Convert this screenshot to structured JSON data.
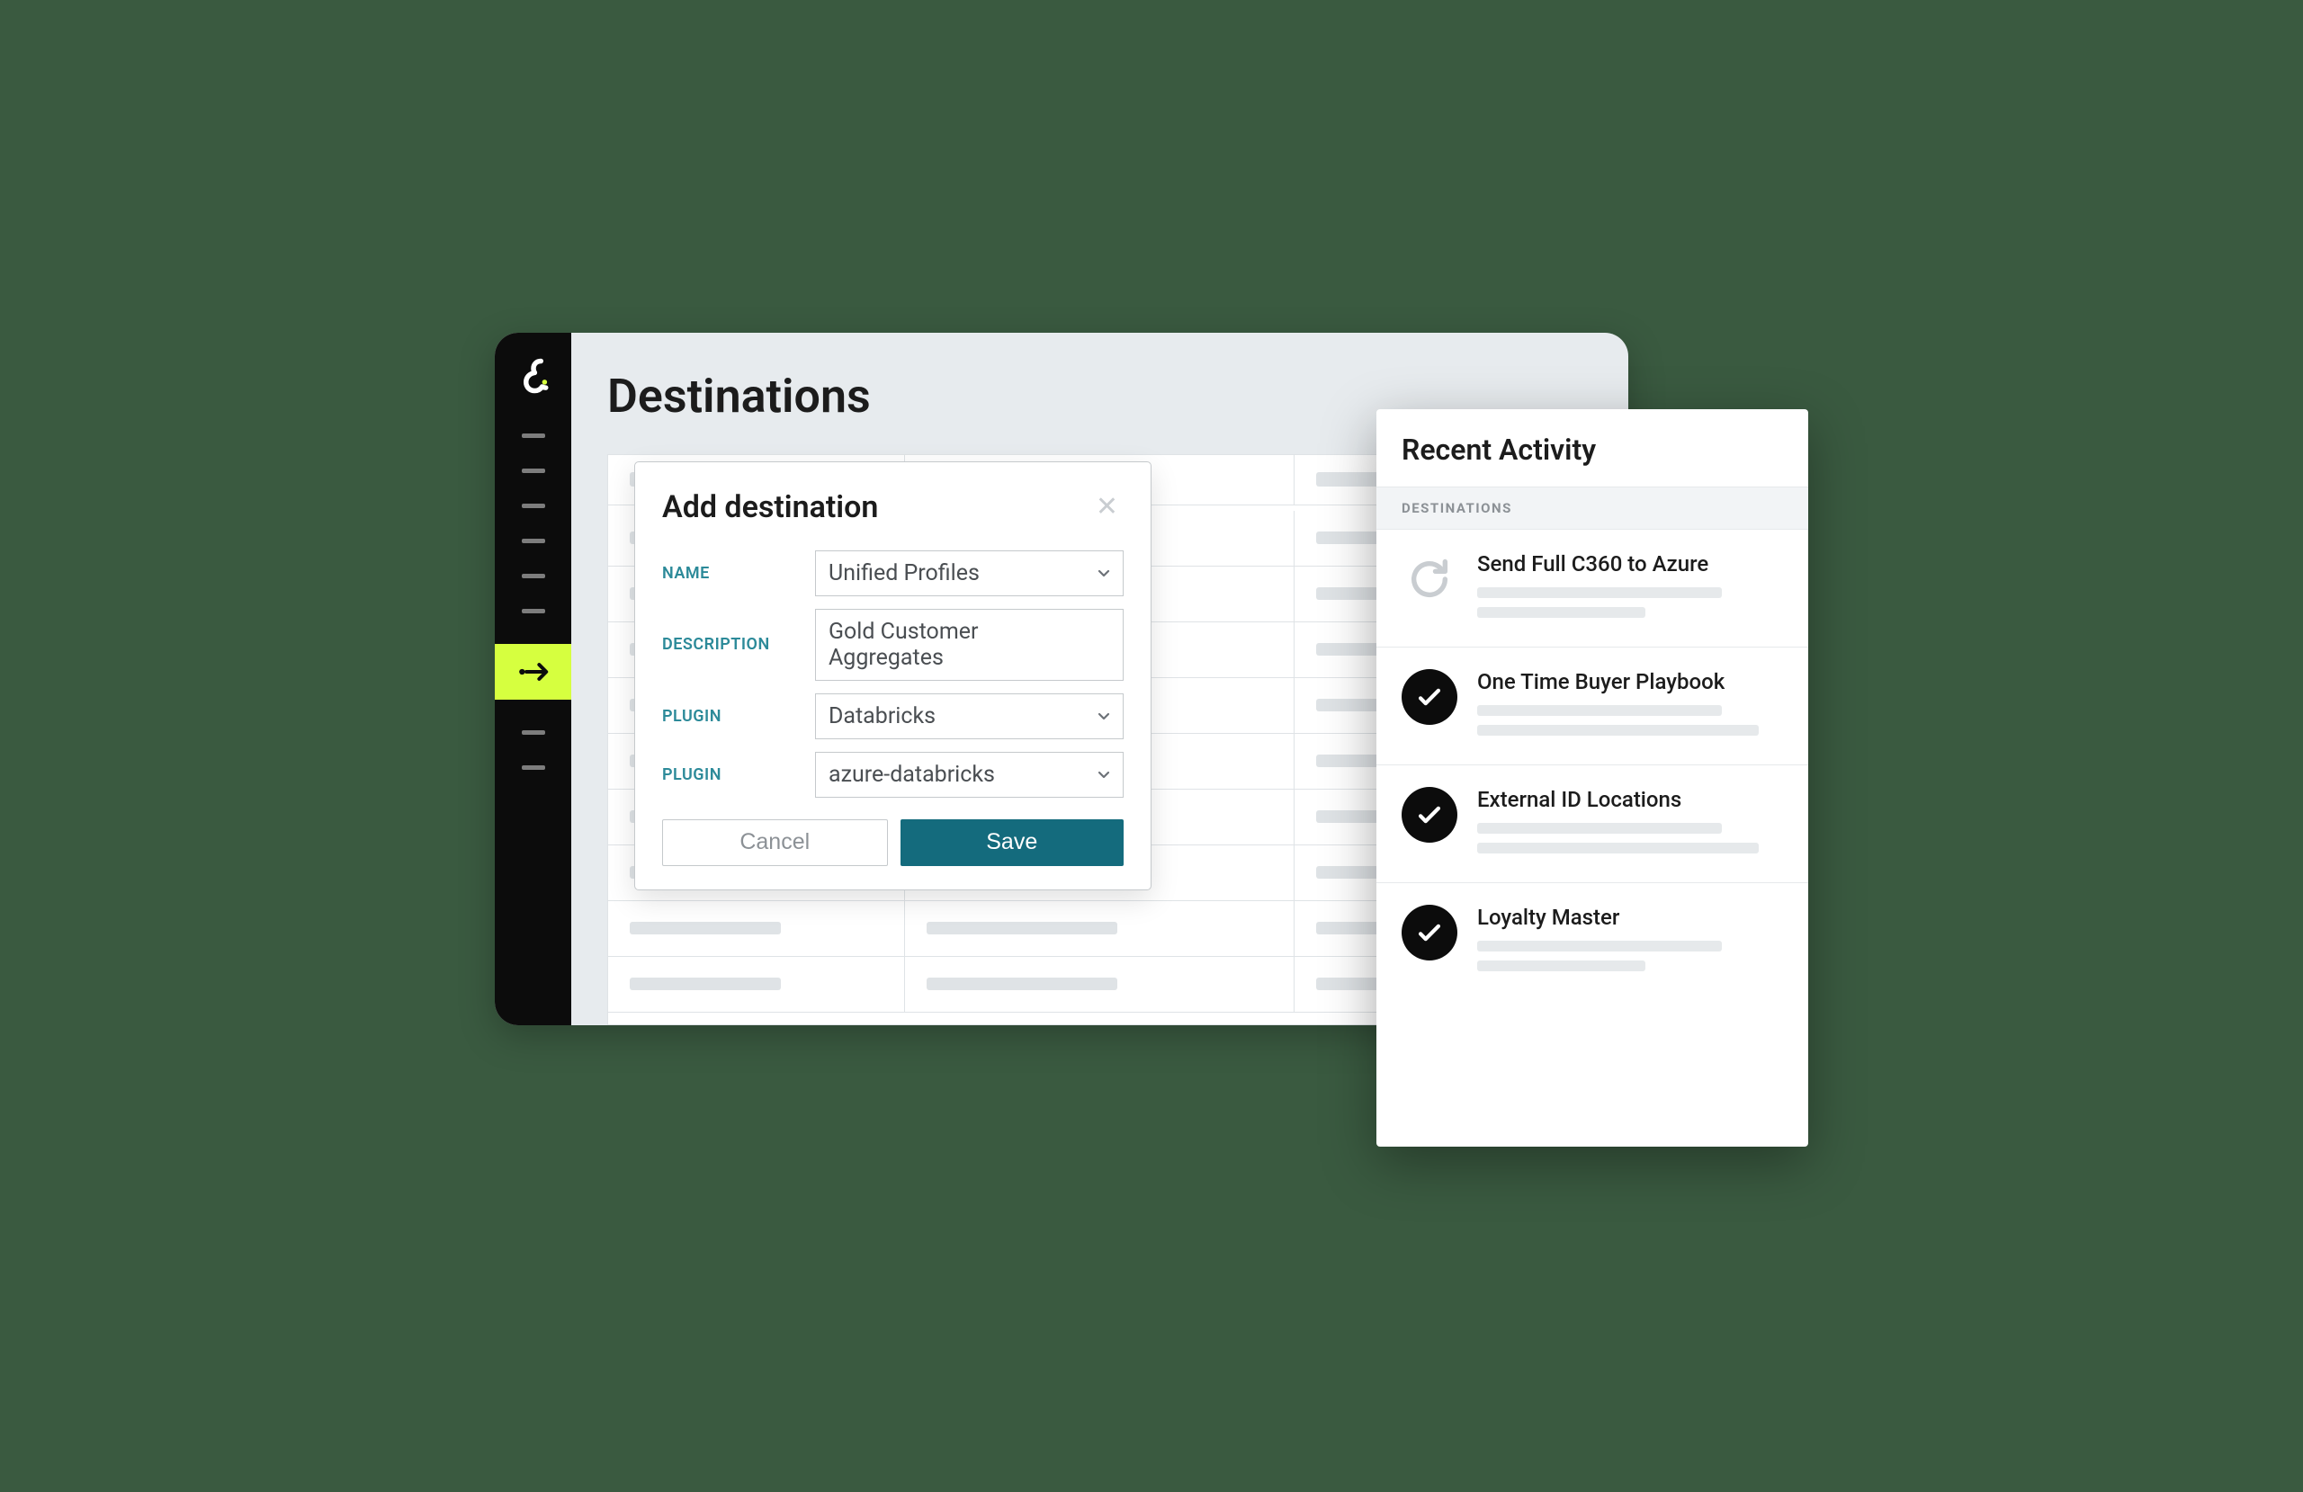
{
  "page": {
    "title": "Destinations"
  },
  "modal": {
    "title": "Add destination",
    "labels": {
      "name": "NAME",
      "description": "DESCRIPTION",
      "plugin1": "PLUGIN",
      "plugin2": "PLUGIN"
    },
    "values": {
      "name": "Unified Profiles",
      "description": "Gold Customer Aggregates",
      "plugin1": "Databricks",
      "plugin2": "azure-databricks"
    },
    "buttons": {
      "cancel": "Cancel",
      "save": "Save"
    }
  },
  "panel": {
    "title": "Recent Activity",
    "section": "DESTINATIONS",
    "items": [
      {
        "title": "Send Full C360 to Azure",
        "status": "running"
      },
      {
        "title": "One Time Buyer Playbook",
        "status": "done"
      },
      {
        "title": "External ID Locations",
        "status": "done"
      },
      {
        "title": "Loyalty Master",
        "status": "done"
      }
    ]
  }
}
